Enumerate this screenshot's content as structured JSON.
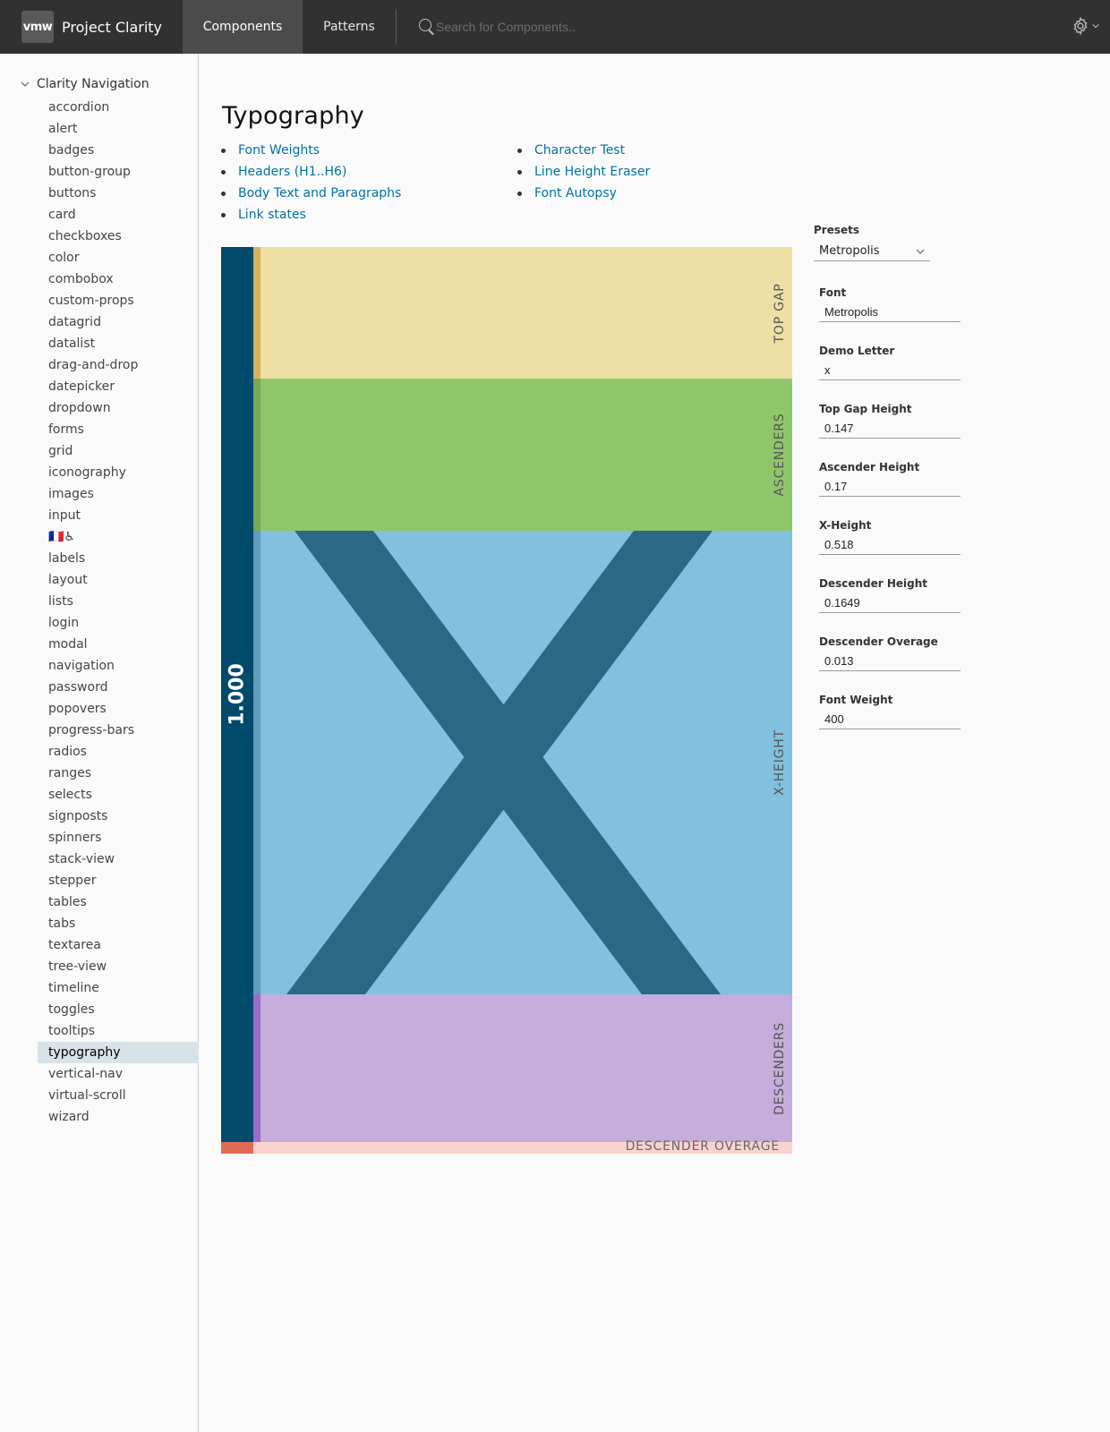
{
  "header": {
    "logo_text": "vmw",
    "brand_title": "Project Clarity",
    "tabs": [
      {
        "label": "Components",
        "active": true
      },
      {
        "label": "Patterns",
        "active": false
      }
    ],
    "search_placeholder": "Search for Components..",
    "settings_icon": "gear-icon"
  },
  "sidebar": {
    "group_label": "Clarity Navigation",
    "items": [
      "accordion",
      "alert",
      "badges",
      "button-group",
      "buttons",
      "card",
      "checkboxes",
      "color",
      "combobox",
      "custom-props",
      "datagrid",
      "datalist",
      "drag-and-drop",
      "datepicker",
      "dropdown",
      "forms",
      "grid",
      "iconography",
      "images",
      "input",
      "🇫🇷♿",
      "labels",
      "layout",
      "lists",
      "login",
      "modal",
      "navigation",
      "password",
      "popovers",
      "progress-bars",
      "radios",
      "ranges",
      "selects",
      "signposts",
      "spinners",
      "stack-view",
      "stepper",
      "tables",
      "tabs",
      "textarea",
      "tree-view",
      "timeline",
      "toggles",
      "tooltips",
      "typography",
      "vertical-nav",
      "virtual-scroll",
      "wizard"
    ],
    "active_item": "typography"
  },
  "main": {
    "title": "Typography",
    "toc_left": [
      "Font Weights",
      "Headers (H1..H6)",
      "Body Text and Paragraphs",
      "Link states"
    ],
    "toc_right": [
      "Character Test",
      "Line Height Eraser",
      "Font Autopsy"
    ]
  },
  "diagram": {
    "total_label": "1.000",
    "demo_letter": "x",
    "bands": [
      {
        "key": "top_gap",
        "label": "TOP GAP",
        "value": 0.147,
        "color": "#eee0a4",
        "edge": "#d6b35a"
      },
      {
        "key": "ascenders",
        "label": "ASCENDERS",
        "value": 0.17,
        "color": "#8fc66a",
        "edge": "#78a85a"
      },
      {
        "key": "x_height",
        "label": "X-HEIGHT",
        "value": 0.518,
        "color": "#81c0df",
        "edge": "#5f9cbd"
      },
      {
        "key": "descenders",
        "label": "DESCENDERS",
        "value": 0.1649,
        "color": "#c6addb",
        "edge": "#9c6ac9"
      }
    ],
    "overage": {
      "label": "DESCENDER OVERAGE",
      "value": 0.013,
      "color": "#f9d3cf",
      "edge": "#e16a55"
    },
    "bar_color": "#004a6b",
    "letter_color": "#296985"
  },
  "panel": {
    "presets_label": "Presets",
    "presets_value": "Metropolis",
    "fields": [
      {
        "label": "Font",
        "value": "Metropolis"
      },
      {
        "label": "Demo Letter",
        "value": "x"
      },
      {
        "label": "Top Gap Height",
        "value": "0.147"
      },
      {
        "label": "Ascender Height",
        "value": "0.17"
      },
      {
        "label": "X-Height",
        "value": "0.518"
      },
      {
        "label": "Descender Height",
        "value": "0.1649"
      },
      {
        "label": "Descender Overage",
        "value": "0.013"
      },
      {
        "label": "Font Weight",
        "value": "400"
      }
    ]
  }
}
